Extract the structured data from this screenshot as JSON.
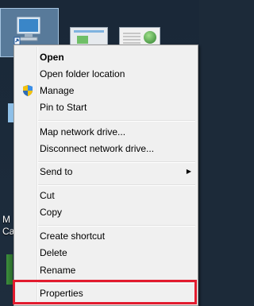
{
  "desktop": {
    "labels": [
      "M",
      "Ca"
    ]
  },
  "context_menu": {
    "groups": [
      [
        {
          "label": "Open",
          "bold": true
        },
        {
          "label": "Open folder location"
        },
        {
          "label": "Manage",
          "icon": "shield-icon"
        },
        {
          "label": "Pin to Start"
        }
      ],
      [
        {
          "label": "Map network drive..."
        },
        {
          "label": "Disconnect network drive..."
        }
      ],
      [
        {
          "label": "Send to",
          "submenu": true
        }
      ],
      [
        {
          "label": "Cut"
        },
        {
          "label": "Copy"
        }
      ],
      [
        {
          "label": "Create shortcut"
        },
        {
          "label": "Delete"
        },
        {
          "label": "Rename"
        }
      ],
      [
        {
          "label": "Properties"
        }
      ]
    ]
  },
  "colors": {
    "highlight": "#e21b2e",
    "menu_bg": "#f0f0f0",
    "desktop_bg": "#1b2a3a"
  }
}
